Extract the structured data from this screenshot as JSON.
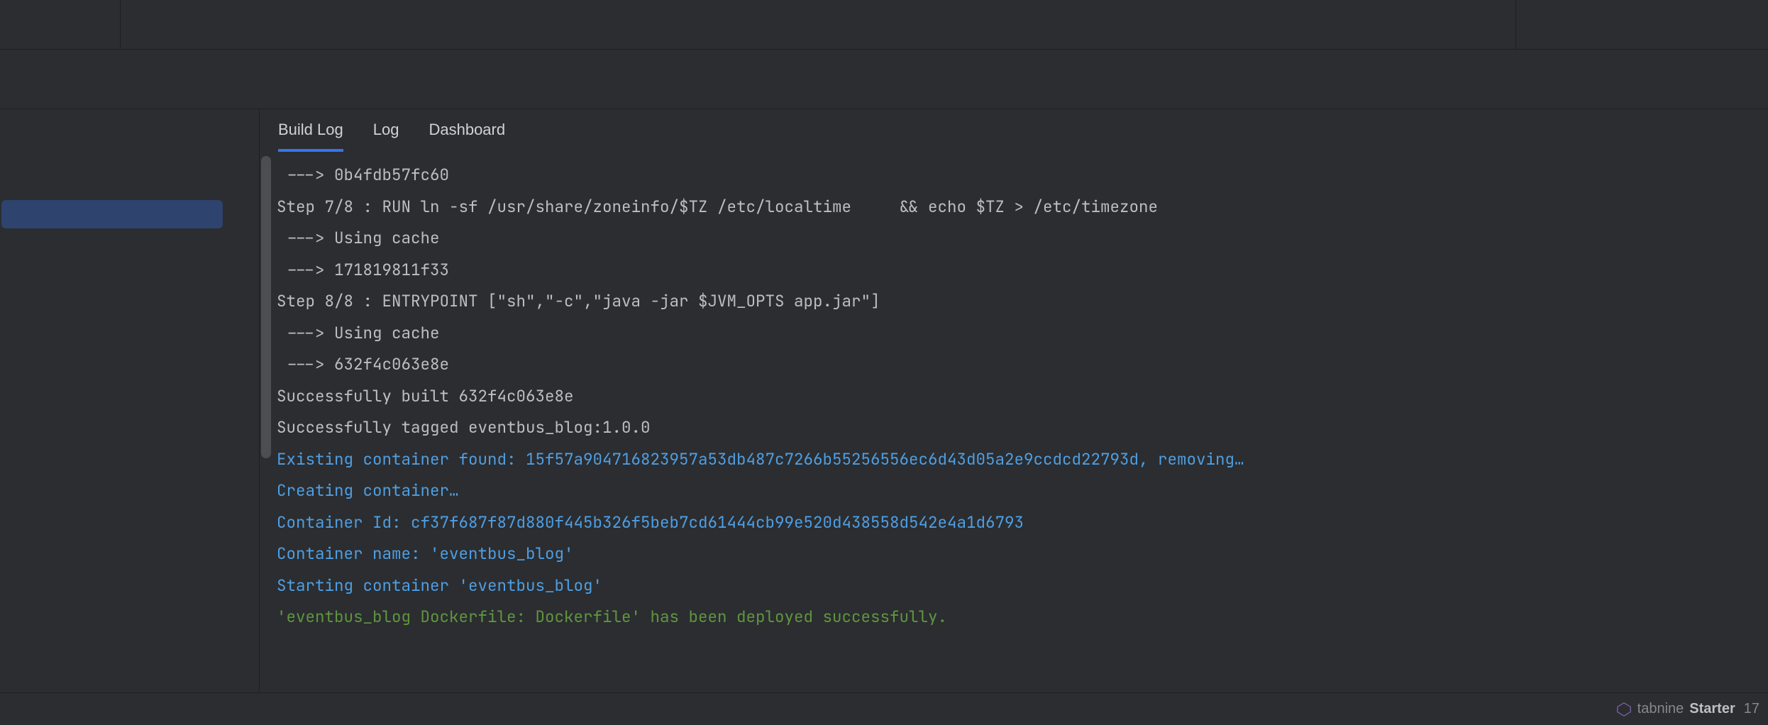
{
  "tabs": [
    {
      "label": "Build Log",
      "active": true
    },
    {
      "label": "Log",
      "active": false
    },
    {
      "label": "Dashboard",
      "active": false
    }
  ],
  "log": {
    "lines": [
      {
        "text": " ---> 0b4fdb57fc60",
        "cls": ""
      },
      {
        "text": "Step 7/8 : RUN ln -sf /usr/share/zoneinfo/$TZ /etc/localtime     && echo $TZ > /etc/timezone",
        "cls": ""
      },
      {
        "text": " ---> Using cache",
        "cls": ""
      },
      {
        "text": " ---> 171819811f33",
        "cls": ""
      },
      {
        "text": "Step 8/8 : ENTRYPOINT [\"sh\",\"-c\",\"java -jar $JVM_OPTS app.jar\"]",
        "cls": ""
      },
      {
        "text": " ---> Using cache",
        "cls": ""
      },
      {
        "text": " ---> 632f4c063e8e",
        "cls": ""
      },
      {
        "text": "",
        "cls": ""
      },
      {
        "text": "Successfully built 632f4c063e8e",
        "cls": ""
      },
      {
        "text": "Successfully tagged eventbus_blog:1.0.0",
        "cls": ""
      },
      {
        "text": "Existing container found: 15f57a904716823957a53db487c7266b55256556ec6d43d05a2e9ccdcd22793d, removing…",
        "cls": "c-info"
      },
      {
        "text": "Creating container…",
        "cls": "c-info"
      },
      {
        "text": "Container Id: cf37f687f87d880f445b326f5beb7cd61444cb99e520d438558d542e4a1d6793",
        "cls": "c-info"
      },
      {
        "text": "Container name: 'eventbus_blog'",
        "cls": "c-info"
      },
      {
        "text": "Starting container 'eventbus_blog'",
        "cls": "c-info"
      },
      {
        "text": "'eventbus_blog Dockerfile: Dockerfile' has been deployed successfully.",
        "cls": "c-ok"
      }
    ]
  },
  "statusbar": {
    "brand_name": "tabnine",
    "brand_plan": "Starter",
    "line_col": "17"
  }
}
